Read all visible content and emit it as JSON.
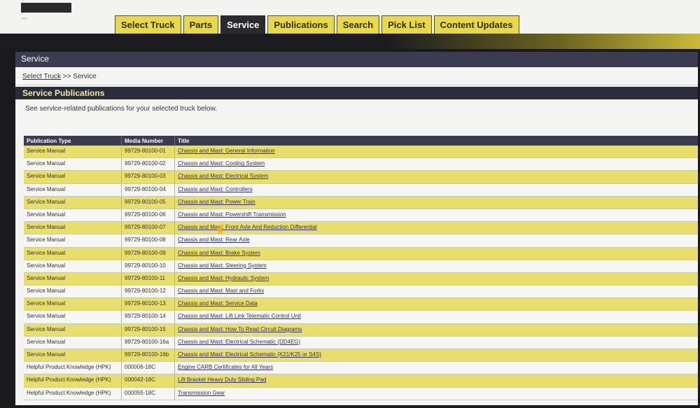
{
  "header": {
    "logo_text": "..."
  },
  "tabs": [
    {
      "label": "Select Truck",
      "active": false
    },
    {
      "label": "Parts",
      "active": false
    },
    {
      "label": "Service",
      "active": true
    },
    {
      "label": "Publications",
      "active": false
    },
    {
      "label": "Search",
      "active": false
    },
    {
      "label": "Pick List",
      "active": false
    },
    {
      "label": "Content Updates",
      "active": false
    }
  ],
  "panel": {
    "title": "Service",
    "breadcrumb_link": "Select Truck",
    "breadcrumb_sep": ">>",
    "breadcrumb_current": "Service",
    "section_title": "Service Publications",
    "description": "See service-related publications for your selected truck below."
  },
  "table": {
    "headers": [
      "Publication Type",
      "Media Number",
      "Title"
    ],
    "rows": [
      [
        "Service Manual",
        "99729-80100-01",
        "Chassis and Mast: General Information"
      ],
      [
        "Service Manual",
        "99729-80100-02",
        "Chassis and Mast: Cooling System"
      ],
      [
        "Service Manual",
        "99729-80100-03",
        "Chassis and Mast: Electrical System"
      ],
      [
        "Service Manual",
        "99729-80100-04",
        "Chassis and Mast: Controllers"
      ],
      [
        "Service Manual",
        "99729-80100-05",
        "Chassis and Mast: Power Train"
      ],
      [
        "Service Manual",
        "99729-80100-06",
        "Chassis and Mast: Powershift Transmission"
      ],
      [
        "Service Manual",
        "99729-80100-07",
        "Chassis and Mast: Front Axle And Reduction Differential"
      ],
      [
        "Service Manual",
        "99729-80100-08",
        "Chassis and Mast: Rear Axle"
      ],
      [
        "Service Manual",
        "99729-80100-09",
        "Chassis and Mast: Brake System"
      ],
      [
        "Service Manual",
        "99729-80100-10",
        "Chassis and Mast: Steering System"
      ],
      [
        "Service Manual",
        "99729-80100-11",
        "Chassis and Mast: Hydraulic System"
      ],
      [
        "Service Manual",
        "99729-80100-12",
        "Chassis and Mast: Mast and Forks"
      ],
      [
        "Service Manual",
        "99729-80100-13",
        "Chassis and Mast: Service Data"
      ],
      [
        "Service Manual",
        "99729-80100-14",
        "Chassis and Mast: Lift Link Telematic Control Unit"
      ],
      [
        "Service Manual",
        "99729-80100-15",
        "Chassis and Mast: How To Read Circuit Diagrams"
      ],
      [
        "Service Manual",
        "99729-80100-16a",
        "Chassis and Mast: Electrical Schematic (DD4EG)"
      ],
      [
        "Service Manual",
        "99729-80100-16b",
        "Chassis and Mast: Electrical Schematic (K21/K25 or S4S)"
      ],
      [
        "Helpful Product Knowledge (HPK)",
        "000006-18C",
        "Engine CARB Certificates for All Years"
      ],
      [
        "Helpful Product Knowledge (HPK)",
        "000042-18C",
        "Lift Bracket Heavy Duty Sliding Pad"
      ],
      [
        "Helpful Product Knowledge (HPK)",
        "000055-18C",
        "Transmission Gear"
      ]
    ]
  }
}
